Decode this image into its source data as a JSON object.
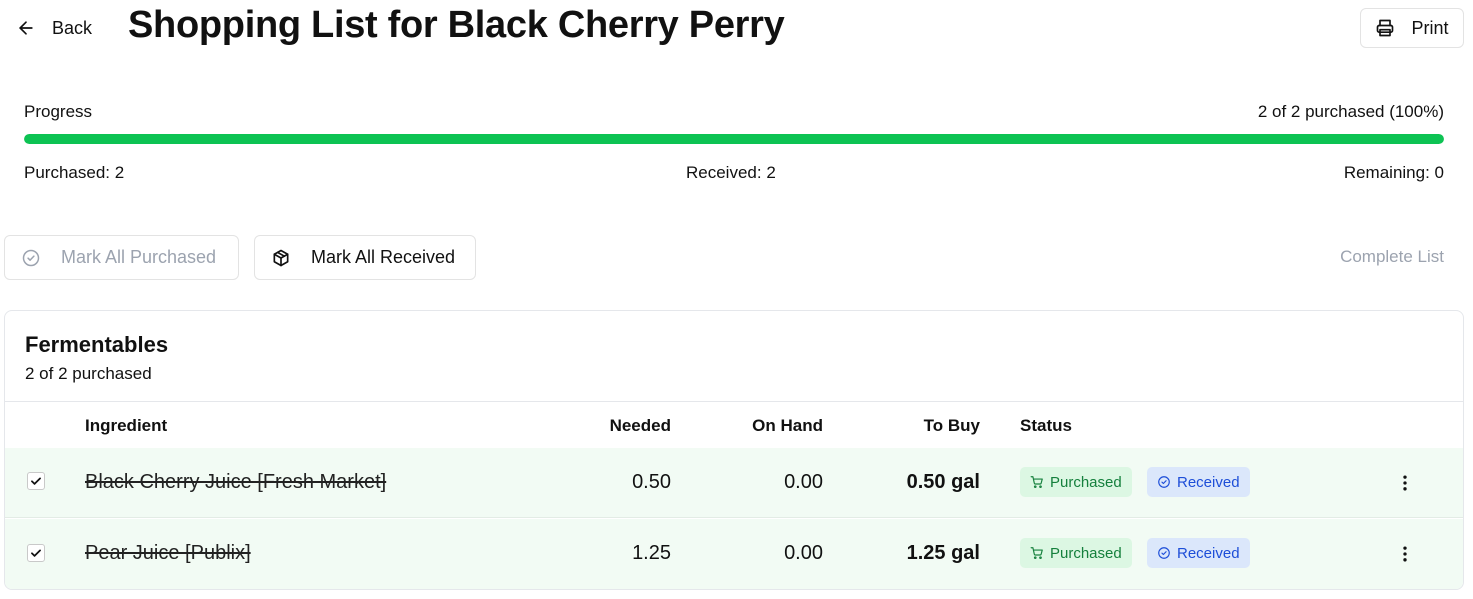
{
  "header": {
    "back_label": "Back",
    "title": "Shopping List for Black Cherry Perry",
    "print_label": "Print"
  },
  "progress": {
    "label": "Progress",
    "count_text": "2 of 2 purchased (100%)",
    "percent": 100,
    "purchased_text": "Purchased: 2",
    "received_text": "Received: 2",
    "remaining_text": "Remaining: 0",
    "bar_color": "#0dc353"
  },
  "actions": {
    "mark_all_purchased": "Mark All Purchased",
    "mark_all_received": "Mark All Received",
    "complete_list": "Complete List"
  },
  "section": {
    "title": "Fermentables",
    "subtitle": "2 of 2 purchased",
    "columns": {
      "ingredient": "Ingredient",
      "needed": "Needed",
      "on_hand": "On Hand",
      "to_buy": "To Buy",
      "status": "Status"
    },
    "rows": [
      {
        "checked": true,
        "name": "Black Cherry Juice [Fresh Market]",
        "needed": "0.50",
        "on_hand": "0.00",
        "to_buy": "0.50 gal",
        "purchased_badge": "Purchased",
        "received_badge": "Received"
      },
      {
        "checked": true,
        "name": "Pear Juice [Publix]",
        "needed": "1.25",
        "on_hand": "0.00",
        "to_buy": "1.25 gal",
        "purchased_badge": "Purchased",
        "received_badge": "Received"
      }
    ]
  },
  "colors": {
    "purchased_badge_bg": "#dcf7e3",
    "purchased_badge_text": "#15803d",
    "received_badge_bg": "#dbe7fb",
    "received_badge_text": "#1d4ed8",
    "row_highlight": "#f2fbf4"
  },
  "icons": {
    "back": "arrow-left-icon",
    "print": "printer-icon",
    "mark_all_purchased": "check-circle-icon",
    "mark_all_received": "package-icon",
    "purchased": "cart-icon",
    "received": "check-circle-icon",
    "row_menu": "more-vertical-icon"
  }
}
